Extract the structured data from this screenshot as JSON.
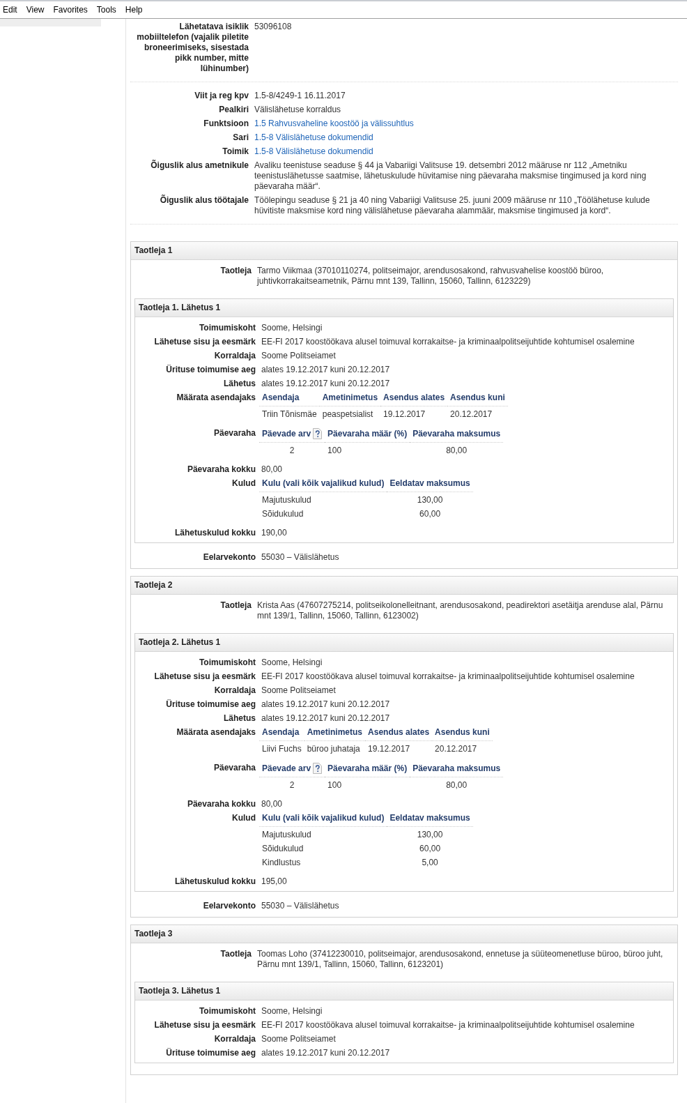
{
  "menu": [
    "Edit",
    "View",
    "Favorites",
    "Tools",
    "Help"
  ],
  "contact_fields": [
    {
      "label": "Lähetatava isiklik mobiiltelefon (vajalik piletite broneerimiseks, sisestada pikk number, mitte lühinumber)",
      "value": "53096108",
      "kind": "text"
    }
  ],
  "document_fields": [
    {
      "label": "Viit ja reg kpv",
      "value": "1.5-8/4249-1 16.11.2017",
      "kind": "text"
    },
    {
      "label": "Pealkiri",
      "value": "Välislähetuse korraldus",
      "kind": "text"
    },
    {
      "label": "Funktsioon",
      "value": "1.5 Rahvusvaheline koostöö ja välissuhtlus",
      "kind": "link"
    },
    {
      "label": "Sari",
      "value": "1.5-8 Välislähetuse dokumendid",
      "kind": "link"
    },
    {
      "label": "Toimik",
      "value": "1.5-8 Välislähetuse dokumendid",
      "kind": "link"
    },
    {
      "label": "Õiguslik alus ametnikule",
      "value": "Avaliku teenistuse seaduse § 44 ja Vabariigi Valitsuse 19. detsembri 2012 määruse nr 112 „Ametniku teenistuslähetusse saatmise, lähetuskulude hüvitamise ning päevaraha maksmise tingimused ja kord ning päevaraha määr“.",
      "kind": "text"
    },
    {
      "label": "Õiguslik alus töötajale",
      "value": "Töölepingu seaduse § 21 ja 40 ning Vabariigi Valitsuse 25. juuni 2009 määruse nr 110 „Töölähetuse kulude hüvitiste maksmise kord ning välislähetuse päevaraha alammäär, maksmise tingimused ja kord“.",
      "kind": "text"
    }
  ],
  "applicants": [
    {
      "title": "Taotleja 1",
      "fields": [
        {
          "label": "Taotleja",
          "value": "Tarmo Viikmaa (37010110274, politseimajor, arendusosakond, rahvusvahelise koostöö büroo, juhtivkorrakaitseametnik, Pärnu mnt 139, Tallinn, 15060, Tallinn, 6123229)",
          "kind": "text"
        }
      ],
      "trips": [
        {
          "title": "Taotleja 1. Lähetus 1",
          "fields": [
            {
              "label": "Toimumiskoht",
              "value": "Soome, Helsingi",
              "kind": "text"
            },
            {
              "label": "Lähetuse sisu ja eesmärk",
              "value": "EE-FI 2017 koostöökava alusel toimuval korrakaitse- ja kriminaalpolitseijuhtide kohtumisel osalemine",
              "kind": "text"
            },
            {
              "label": "Korraldaja",
              "value": "Soome Politseiamet",
              "kind": "text"
            },
            {
              "label": "Ürituse toimumise aeg",
              "value": "alates 19.12.2017 kuni 20.12.2017",
              "kind": "text"
            },
            {
              "label": "Lähetus",
              "value": "alates 19.12.2017 kuni 20.12.2017",
              "kind": "text"
            },
            {
              "label": "Määrata asendajaks",
              "kind": "substitutes",
              "columns": [
                "Asendaja",
                "Ametinimetus",
                "Asendus alates",
                "Asendus kuni"
              ],
              "rows": [
                [
                  "Triin Tõnismäe",
                  "peaspetsialist",
                  "19.12.2017",
                  "20.12.2017"
                ]
              ]
            },
            {
              "label": "Päevaraha",
              "kind": "allowance",
              "columns": [
                "Päevade arv",
                "Päevaraha määr (%)",
                "Päevaraha maksumus"
              ],
              "rows": [
                [
                  "2",
                  "100",
                  "80,00"
                ]
              ]
            },
            {
              "label": "Päevaraha kokku",
              "value": "80,00",
              "kind": "text"
            },
            {
              "label": "Kulud",
              "kind": "costs",
              "columns": [
                "Kulu (vali kõik vajalikud kulud)",
                "Eeldatav maksumus"
              ],
              "rows": [
                [
                  "Majutuskulud",
                  "130,00"
                ],
                [
                  "Sõidukulud",
                  "60,00"
                ]
              ]
            },
            {
              "label": "Lähetuskulud kokku",
              "value": "190,00",
              "kind": "text"
            }
          ]
        }
      ],
      "budget": {
        "label": "Eelarvekonto",
        "value": "55030 – Välislähetus"
      }
    },
    {
      "title": "Taotleja 2",
      "fields": [
        {
          "label": "Taotleja",
          "value": "Krista Aas (47607275214, politseikolonelleitnant, arendusosakond, peadirektori asetäitja arenduse alal, Pärnu mnt 139/1, Tallinn, 15060, Tallinn, 6123002)",
          "kind": "text"
        }
      ],
      "trips": [
        {
          "title": "Taotleja 2. Lähetus 1",
          "fields": [
            {
              "label": "Toimumiskoht",
              "value": "Soome, Helsingi",
              "kind": "text"
            },
            {
              "label": "Lähetuse sisu ja eesmärk",
              "value": "EE-FI 2017 koostöökava alusel toimuval korrakaitse- ja kriminaalpolitseijuhtide kohtumisel osalemine",
              "kind": "text"
            },
            {
              "label": "Korraldaja",
              "value": "Soome Politseiamet",
              "kind": "text"
            },
            {
              "label": "Ürituse toimumise aeg",
              "value": "alates 19.12.2017 kuni 20.12.2017",
              "kind": "text"
            },
            {
              "label": "Lähetus",
              "value": "alates 19.12.2017 kuni 20.12.2017",
              "kind": "text"
            },
            {
              "label": "Määrata asendajaks",
              "kind": "substitutes",
              "columns": [
                "Asendaja",
                "Ametinimetus",
                "Asendus alates",
                "Asendus kuni"
              ],
              "rows": [
                [
                  "Liivi Fuchs",
                  "büroo juhataja",
                  "19.12.2017",
                  "20.12.2017"
                ]
              ]
            },
            {
              "label": "Päevaraha",
              "kind": "allowance",
              "columns": [
                "Päevade arv",
                "Päevaraha määr (%)",
                "Päevaraha maksumus"
              ],
              "rows": [
                [
                  "2",
                  "100",
                  "80,00"
                ]
              ]
            },
            {
              "label": "Päevaraha kokku",
              "value": "80,00",
              "kind": "text"
            },
            {
              "label": "Kulud",
              "kind": "costs",
              "columns": [
                "Kulu (vali kõik vajalikud kulud)",
                "Eeldatav maksumus"
              ],
              "rows": [
                [
                  "Majutuskulud",
                  "130,00"
                ],
                [
                  "Sõidukulud",
                  "60,00"
                ],
                [
                  "Kindlustus",
                  "5,00"
                ]
              ]
            },
            {
              "label": "Lähetuskulud kokku",
              "value": "195,00",
              "kind": "text"
            }
          ]
        }
      ],
      "budget": {
        "label": "Eelarvekonto",
        "value": "55030 – Välislähetus"
      }
    },
    {
      "title": "Taotleja 3",
      "fields": [
        {
          "label": "Taotleja",
          "value": "Toomas Loho (37412230010, politseimajor, arendusosakond, ennetuse ja süüteomenetluse büroo, büroo juht, Pärnu mnt 139/1, Tallinn, 15060, Tallinn, 6123201)",
          "kind": "text"
        }
      ],
      "trips": [
        {
          "title": "Taotleja 3. Lähetus 1",
          "fields": [
            {
              "label": "Toimumiskoht",
              "value": "Soome, Helsingi",
              "kind": "text"
            },
            {
              "label": "Lähetuse sisu ja eesmärk",
              "value": "EE-FI 2017 koostöökava alusel toimuval korrakaitse- ja kriminaalpolitseijuhtide kohtumisel osalemine",
              "kind": "text"
            },
            {
              "label": "Korraldaja",
              "value": "Soome Politseiamet",
              "kind": "text"
            },
            {
              "label": "Ürituse toimumise aeg",
              "value": "alates 19.12.2017 kuni 20.12.2017",
              "kind": "text"
            }
          ]
        }
      ]
    }
  ]
}
